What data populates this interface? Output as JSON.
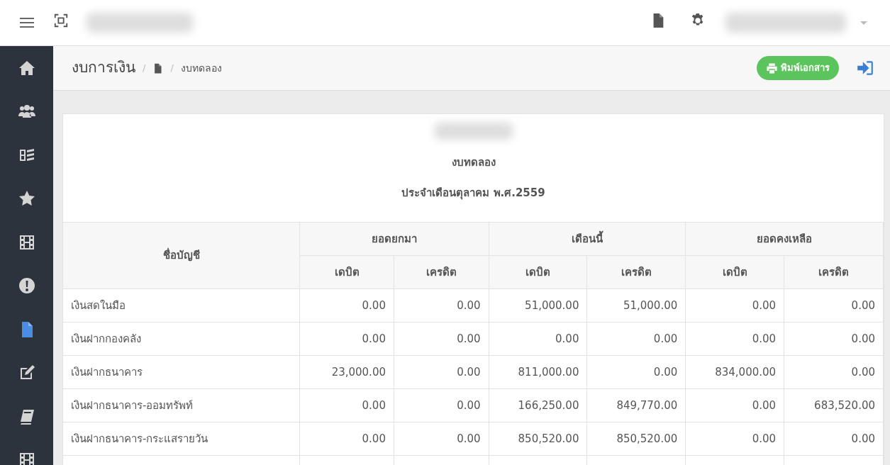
{
  "topbar": {
    "icons": [
      {
        "kind": "menu"
      },
      {
        "kind": "fullscreen"
      },
      {
        "kind": "document"
      },
      {
        "kind": "settings"
      }
    ]
  },
  "sidebar": {
    "items": [
      {
        "kind": "home",
        "selected": false
      },
      {
        "kind": "users",
        "selected": false
      },
      {
        "kind": "ledger",
        "selected": false
      },
      {
        "kind": "star",
        "selected": false
      },
      {
        "kind": "film",
        "selected": false
      },
      {
        "kind": "alert",
        "selected": false
      },
      {
        "kind": "document",
        "selected": true
      },
      {
        "kind": "edit",
        "selected": false
      },
      {
        "kind": "book",
        "selected": false
      },
      {
        "kind": "film",
        "selected": false
      }
    ]
  },
  "breadcrumb": {
    "title": "งบการเงิน",
    "separators": [
      "/",
      "/"
    ],
    "current": "งบทดลอง"
  },
  "print_button": "พิมพ์เอกสาร",
  "report": {
    "title": "งบทดลอง",
    "subtitle": "ประจำเดือนตุลาคม พ.ศ.2559"
  },
  "table": {
    "name_column": "ชื่อบัญชี",
    "groups": [
      {
        "label": "ยอดยกมา",
        "columns": [
          "เดบิต",
          "เครดิต"
        ]
      },
      {
        "label": "เดือนนี้",
        "columns": [
          "เดบิต",
          "เครดิต"
        ]
      },
      {
        "label": "ยอดคงเหลือ",
        "columns": [
          "เดบิต",
          "เครดิต"
        ]
      }
    ],
    "rows": [
      {
        "name": "เงินสดในมือ",
        "values": [
          "0.00",
          "0.00",
          "51,000.00",
          "51,000.00",
          "0.00",
          "0.00"
        ]
      },
      {
        "name": "เงินฝากกองคลัง",
        "values": [
          "0.00",
          "0.00",
          "0.00",
          "0.00",
          "0.00",
          "0.00"
        ]
      },
      {
        "name": "เงินฝากธนาคาร",
        "values": [
          "23,000.00",
          "0.00",
          "811,000.00",
          "0.00",
          "834,000.00",
          "0.00"
        ]
      },
      {
        "name": "เงินฝากธนาคาร-ออมทรัพท์",
        "values": [
          "0.00",
          "0.00",
          "166,250.00",
          "849,770.00",
          "0.00",
          "683,520.00"
        ]
      },
      {
        "name": "เงินฝากธนาคาร-กระแสรายวัน",
        "values": [
          "0.00",
          "0.00",
          "850,520.00",
          "850,520.00",
          "0.00",
          "0.00"
        ]
      }
    ]
  }
}
